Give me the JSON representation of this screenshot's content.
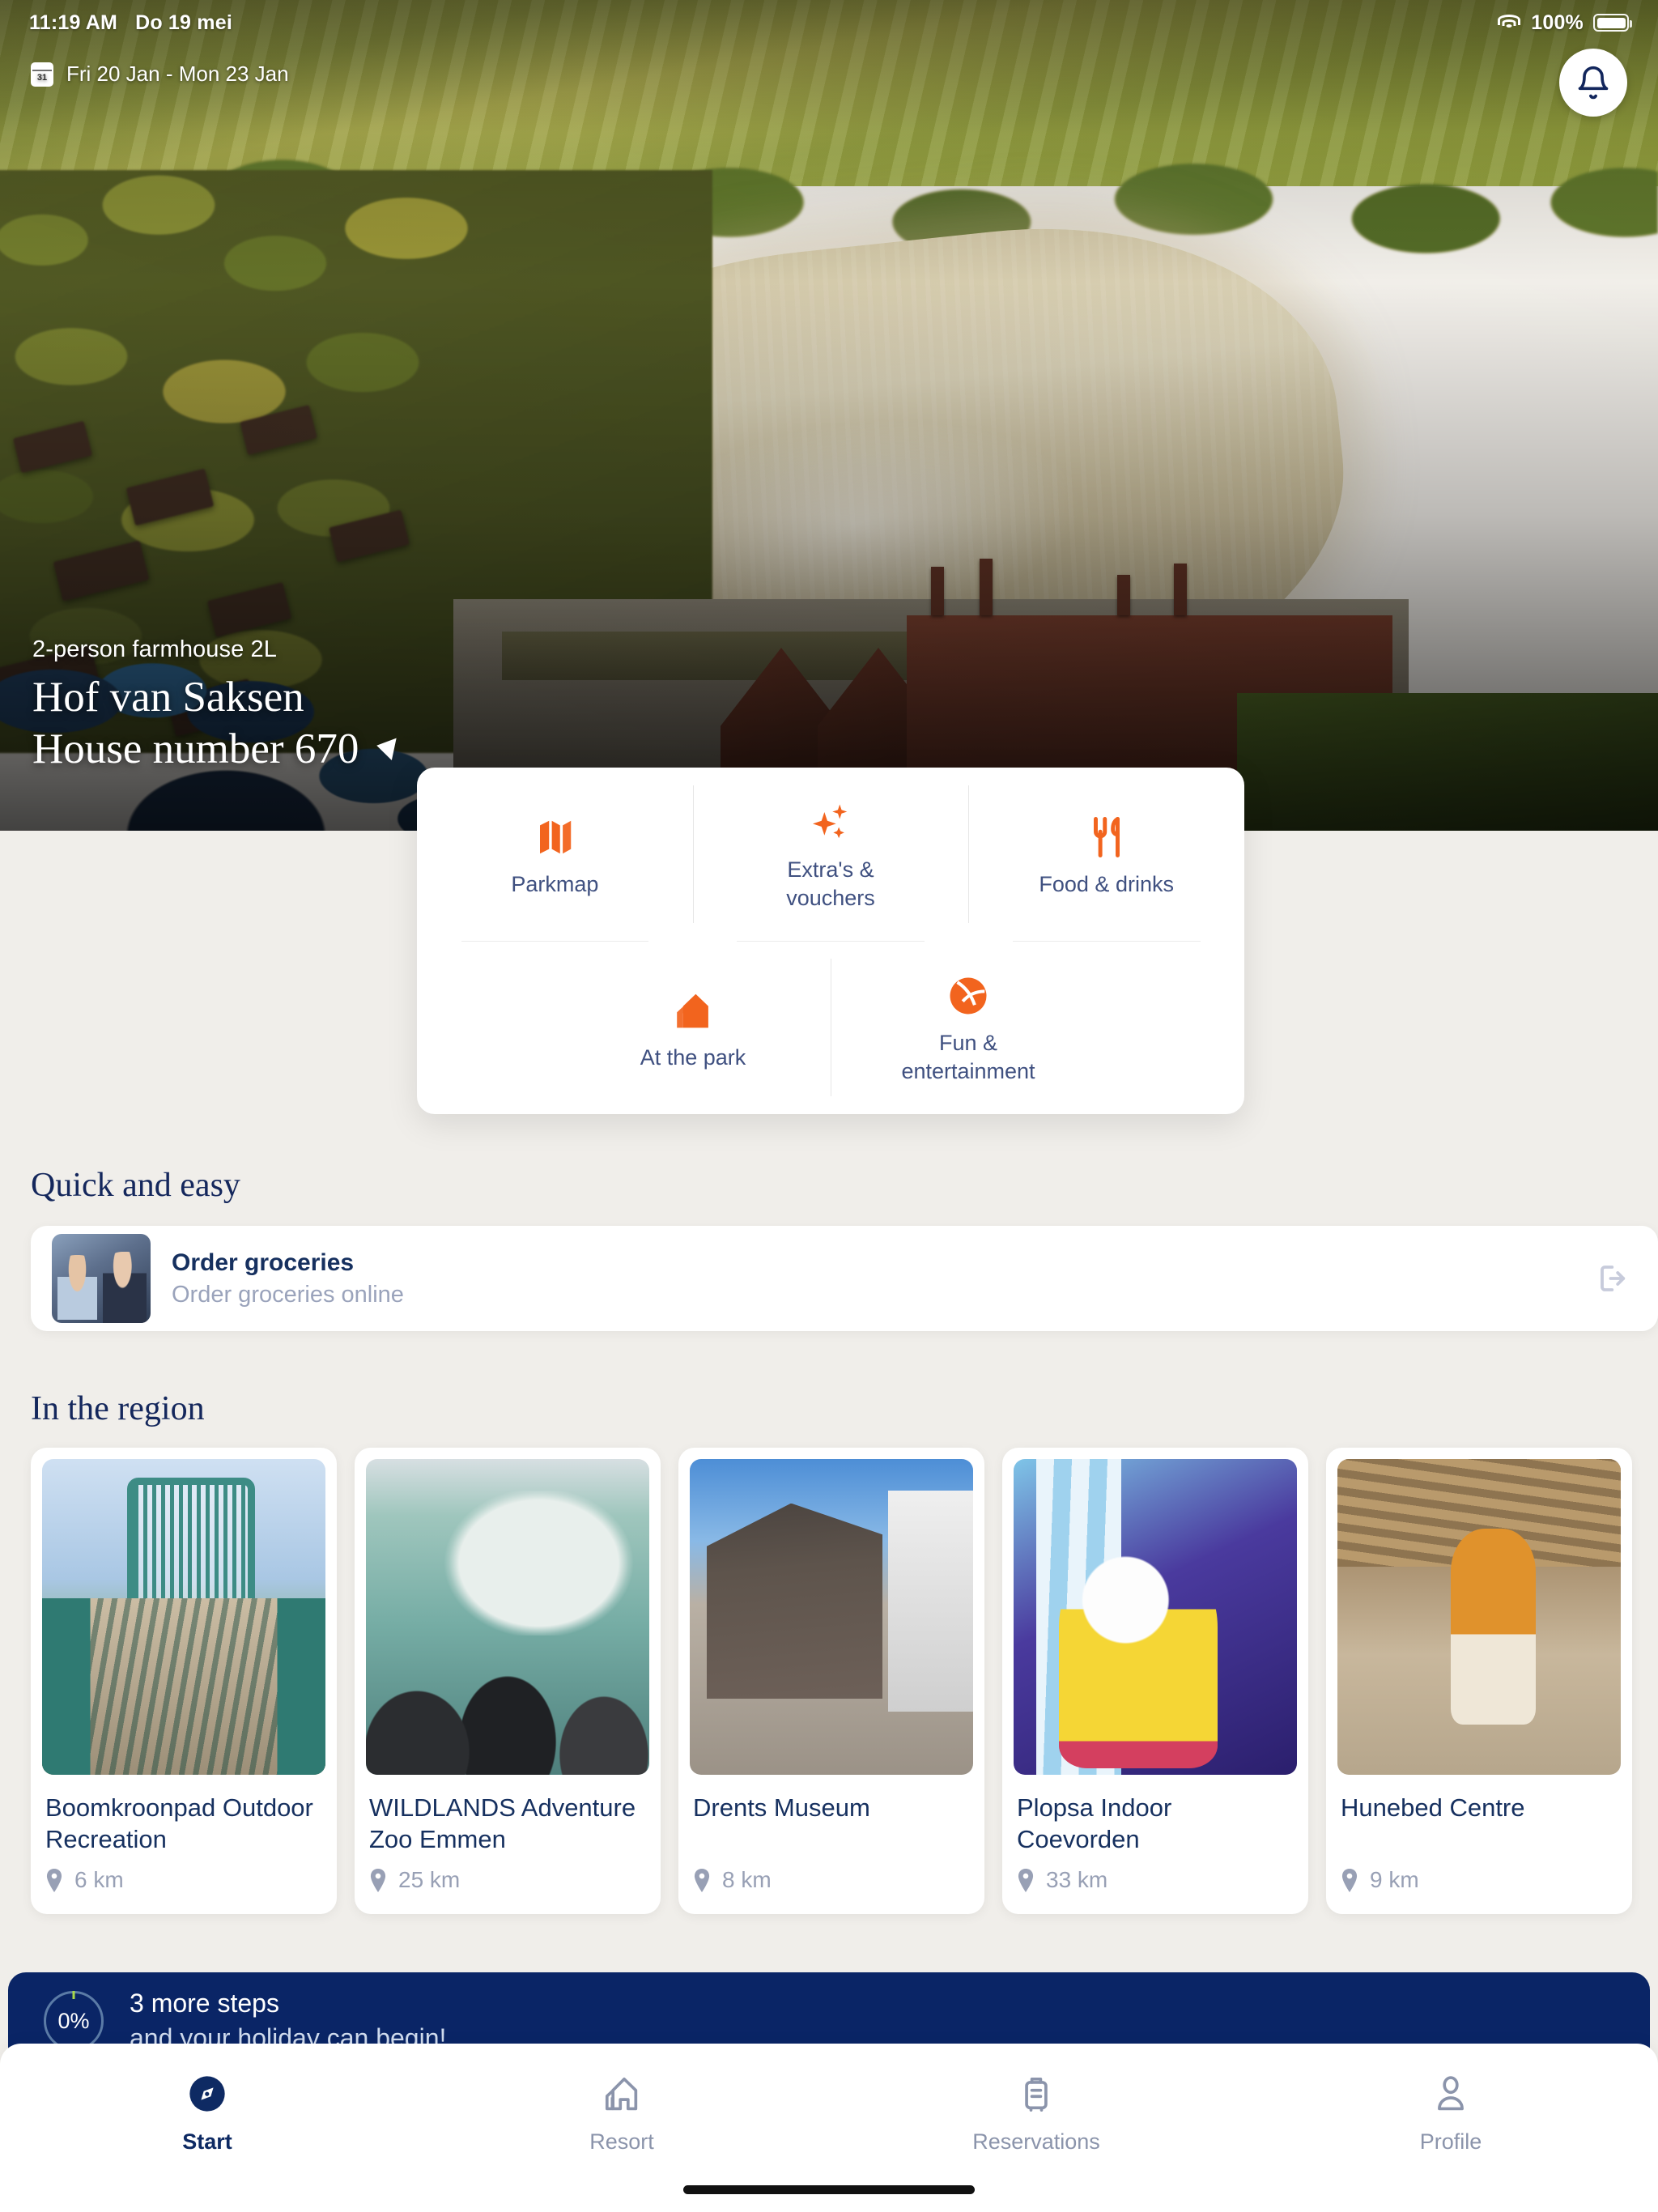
{
  "status_bar": {
    "time": "11:19 AM",
    "date": "Do 19 mei",
    "battery_percent": "100%",
    "wifi_icon": "wifi-icon",
    "battery_icon": "battery-icon"
  },
  "hero": {
    "date_range": "Fri 20 Jan - Mon 23 Jan",
    "calendar_icon_day": "31",
    "notification_icon": "bell-icon",
    "subtitle": "2-person farmhouse 2L",
    "title": "Hof van Saksen",
    "house_number": "House number 670",
    "location_icon": "location-arrow-icon"
  },
  "quick_actions": [
    {
      "label": "Parkmap",
      "icon": "map-icon"
    },
    {
      "label": "Extra's & vouchers",
      "icon": "sparkles-icon"
    },
    {
      "label": "Food & drinks",
      "icon": "cutlery-icon"
    },
    {
      "label": "At the park",
      "icon": "houses-icon"
    },
    {
      "label": "Fun & entertainment",
      "icon": "ball-icon"
    }
  ],
  "quick_and_easy": {
    "section_title": "Quick and easy",
    "item": {
      "title": "Order groceries",
      "description": "Order groceries online",
      "action_icon": "external-link-icon",
      "thumbnail": "couple-dining-photo"
    }
  },
  "in_the_region": {
    "section_title": "In the region",
    "distance_icon": "map-pin-icon",
    "cards": [
      {
        "name": "Boomkroonpad Outdoor Recreation",
        "distance": "6 km",
        "photo": "treetop-walkway-photo"
      },
      {
        "name": "WILDLANDS Adventure Zoo Emmen",
        "distance": "25 km",
        "photo": "polar-bear-underwater-photo"
      },
      {
        "name": "Drents Museum",
        "distance": "8 km",
        "photo": "museum-street-photo"
      },
      {
        "name": "Plopsa Indoor Coevorden",
        "distance": "33 km",
        "photo": "plopsa-mascot-photo"
      },
      {
        "name": "Hunebed Centre",
        "distance": "9 km",
        "photo": "prehistoric-reenactment-photo"
      }
    ]
  },
  "progress_banner": {
    "percent": "0%",
    "line1": "3 more steps",
    "line2": "and your holiday can begin!",
    "background_color": "#0a2566"
  },
  "tab_bar": {
    "items": [
      {
        "label": "Start",
        "icon": "compass-icon",
        "active": true
      },
      {
        "label": "Resort",
        "icon": "houses-outline-icon",
        "active": false
      },
      {
        "label": "Reservations",
        "icon": "suitcase-icon",
        "active": false
      },
      {
        "label": "Profile",
        "icon": "person-icon",
        "active": false
      }
    ]
  },
  "colors": {
    "accent_orange": "#f2641e",
    "brand_navy": "#14275c",
    "page_background": "#f0eeea",
    "muted_text": "#98a0b5"
  }
}
